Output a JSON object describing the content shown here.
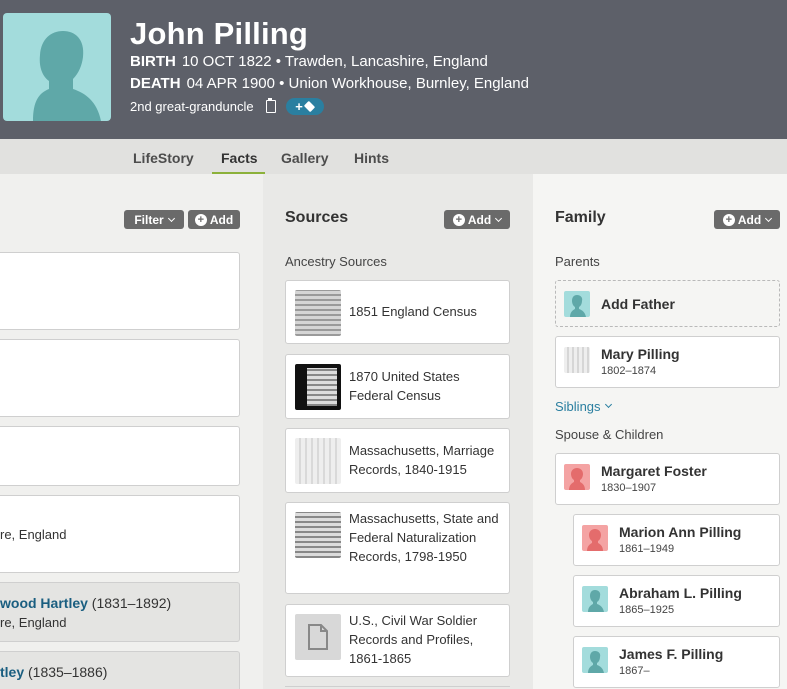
{
  "person": {
    "name": "John Pilling",
    "birth_label": "BIRTH",
    "birth_value": "10 OCT 1822 • Trawden, Lancashire, England",
    "death_label": "DEATH",
    "death_value": "04 APR 1900 • Union Workhouse, Burnley, England",
    "relation": "2nd great-granduncle",
    "tag_plus": "+"
  },
  "tabs": [
    {
      "label": "LifeStory"
    },
    {
      "label": "Facts"
    },
    {
      "label": "Gallery"
    },
    {
      "label": "Hints"
    }
  ],
  "facts_col": {
    "filter_label": "Filter",
    "add_label": "Add",
    "cards": [
      {
        "line1": "",
        "line2": ""
      },
      {
        "line1": "",
        "line2": ""
      },
      {
        "line1": "",
        "line2": ""
      },
      {
        "line1": "",
        "line2": "re, England"
      },
      {
        "link": "wood Hartley",
        "years": " (1831–1892)",
        "line2": "re, England"
      },
      {
        "link": "tley",
        "years": " (1835–1886)",
        "line2": ""
      }
    ]
  },
  "sources_col": {
    "title": "Sources",
    "add_label": "Add",
    "section": "Ancestry Sources",
    "items": [
      {
        "title": "1851 England Census"
      },
      {
        "title": "1870 United States Federal Census"
      },
      {
        "title": "Massachusetts, Marriage Records, 1840-1915"
      },
      {
        "title": "Massachusetts, State and Federal Naturalization Records, 1798-1950"
      },
      {
        "title": "U.S., Civil War Soldier Records and Profiles, 1861-1865"
      }
    ]
  },
  "family_col": {
    "title": "Family",
    "add_label": "Add",
    "parents_label": "Parents",
    "add_father": "Add Father",
    "mother": {
      "name": "Mary Pilling",
      "dates": "1802–1874"
    },
    "siblings_label": "Siblings",
    "spouse_label": "Spouse & Children",
    "spouse": {
      "name": "Margaret Foster",
      "dates": "1830–1907"
    },
    "children": [
      {
        "name": "Marion Ann Pilling",
        "dates": "1861–1949"
      },
      {
        "name": "Abraham L. Pilling",
        "dates": "1865–1925"
      },
      {
        "name": "James F. Pilling",
        "dates": "1867–"
      }
    ]
  },
  "colors": {
    "header_bg": "#5d6069",
    "avatar_teal": "#a3dcdc",
    "avatar_female": "#f4a3a3",
    "link_blue": "#1a5e80",
    "tab_accent": "#8cb13a",
    "button_grey": "#6a6a6a"
  },
  "icons": [
    "person-silhouette-icon",
    "clipboard-icon",
    "tag-icon",
    "plus-icon",
    "chevron-down-icon",
    "document-icon"
  ]
}
